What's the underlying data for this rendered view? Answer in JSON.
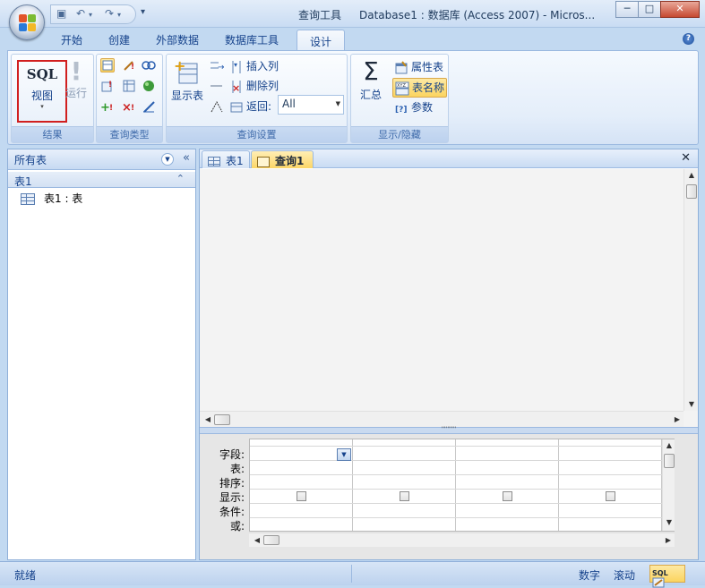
{
  "window": {
    "tool_title": "查询工具",
    "title": "Database1 : 数据库 (Access 2007) - Micros...",
    "controls": [
      "─",
      "□",
      "✕"
    ]
  },
  "qat": {
    "more": "▾"
  },
  "ribbon": {
    "tabs": [
      "开始",
      "创建",
      "外部数据",
      "数据库工具",
      "设计"
    ],
    "active_tab": "设计",
    "help": "?",
    "groups": {
      "results": {
        "label": "结果",
        "sql_text": "SQL",
        "view_label": "视图",
        "view_arrow": "▾",
        "run_label": "运行",
        "run_glyph": "!"
      },
      "query_type": {
        "label": "查询类型"
      },
      "query_setup": {
        "label": "查询设置",
        "show_table": "显示表",
        "insert_column": "插入列",
        "delete_column": "删除列",
        "return_label": "返回:",
        "return_value": "All"
      },
      "show_hide": {
        "label": "显示/隐藏",
        "totals_symbol": "Σ",
        "totals": "汇总",
        "property_sheet": "属性表",
        "table_names": "表名称",
        "parameters": "参数"
      }
    }
  },
  "nav_pane": {
    "header": "所有表",
    "collapse_glyph": "«",
    "group": "表1",
    "group_glyph": "⌃",
    "items": [
      {
        "label": "表1 : 表"
      }
    ]
  },
  "document": {
    "tabs": [
      {
        "label": "表1"
      },
      {
        "label": "查询1"
      }
    ],
    "close_glyph": "✕",
    "row_labels": [
      "字段:",
      "表:",
      "排序:",
      "显示:",
      "条件:",
      "或:"
    ]
  },
  "status_bar": {
    "left": "就绪",
    "num": "数字",
    "scroll": "滚动",
    "view_label": "SQL"
  },
  "colors": {
    "accent": "#15428b",
    "highlight": "#fbd45f",
    "sql_border": "#d11f1f"
  }
}
